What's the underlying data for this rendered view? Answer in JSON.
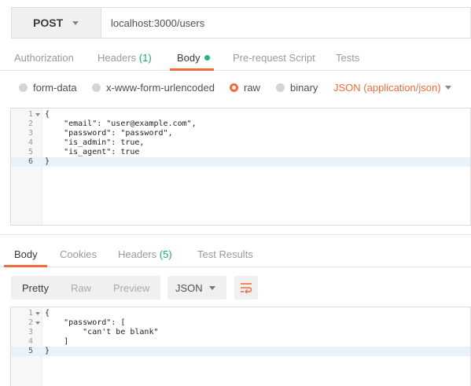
{
  "request": {
    "method": "POST",
    "url": "localhost:3000/users"
  },
  "request_tabs": [
    {
      "label": "Authorization"
    },
    {
      "label": "Headers",
      "count": "(1)"
    },
    {
      "label": "Body",
      "active": true
    },
    {
      "label": "Pre-request Script"
    },
    {
      "label": "Tests"
    }
  ],
  "body_types": [
    {
      "label": "form-data",
      "selected": false
    },
    {
      "label": "x-www-form-urlencoded",
      "selected": false
    },
    {
      "label": "raw",
      "selected": true
    },
    {
      "label": "binary",
      "selected": false
    }
  ],
  "content_type": "JSON (application/json)",
  "request_body": {
    "lines": [
      {
        "n": "1",
        "text": "{"
      },
      {
        "n": "2",
        "text": "    \"email\": \"user@example.com\","
      },
      {
        "n": "3",
        "text": "    \"password\": \"password\","
      },
      {
        "n": "4",
        "text": "    \"is_admin\": true,"
      },
      {
        "n": "5",
        "text": "    \"is_agent\": true"
      },
      {
        "n": "6",
        "text": "}"
      }
    ]
  },
  "response_tabs": [
    {
      "label": "Body",
      "active": true
    },
    {
      "label": "Cookies"
    },
    {
      "label": "Headers",
      "count": "(5)"
    },
    {
      "label": "Test Results"
    }
  ],
  "response_view": {
    "modes": [
      "Pretty",
      "Raw",
      "Preview"
    ],
    "active_mode": "Pretty",
    "format": "JSON",
    "wrap_icon": "wrap-lines-icon"
  },
  "response_body": {
    "lines": [
      {
        "n": "1",
        "text": "{"
      },
      {
        "n": "2",
        "text": "    \"password\": ["
      },
      {
        "n": "3",
        "text": "        \"can't be blank\""
      },
      {
        "n": "4",
        "text": "    ]"
      },
      {
        "n": "5",
        "text": "}"
      }
    ]
  },
  "colors": {
    "accent": "#f26b3a",
    "status_green": "#26b47f",
    "count_green": "#2aa46b"
  }
}
